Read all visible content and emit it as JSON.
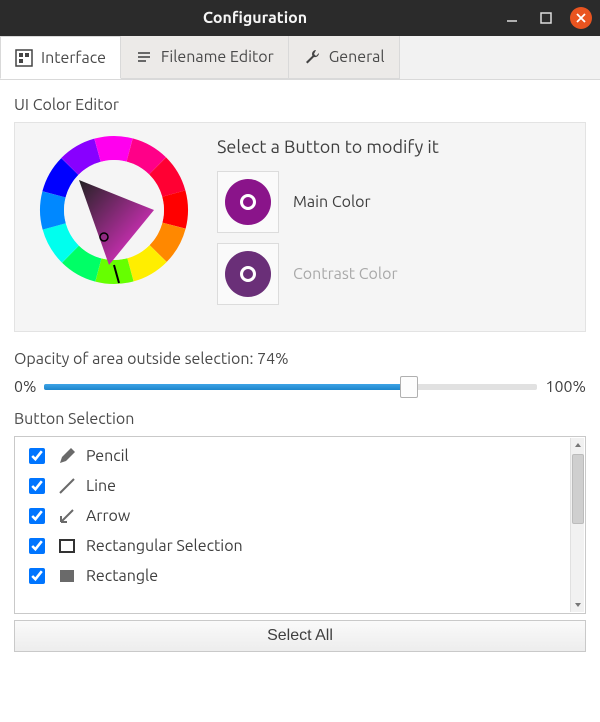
{
  "window": {
    "title": "Configuration"
  },
  "tabs": {
    "interface": "Interface",
    "filename": "Filename Editor",
    "general": "General",
    "active": "interface"
  },
  "colorEditor": {
    "heading": "UI Color Editor",
    "hint": "Select a Button to modify it",
    "main": {
      "label": "Main Color",
      "hex": "#8a148a"
    },
    "contrast": {
      "label": "Contrast Color",
      "hex": "#6a2f78"
    }
  },
  "opacity": {
    "label": "Opacity of area outside selection: 74%",
    "value": 74,
    "minLabel": "0%",
    "maxLabel": "100%"
  },
  "buttonSelection": {
    "heading": "Button Selection",
    "items": [
      {
        "label": "Pencil",
        "checked": true
      },
      {
        "label": "Line",
        "checked": true
      },
      {
        "label": "Arrow",
        "checked": true
      },
      {
        "label": "Rectangular Selection",
        "checked": true
      },
      {
        "label": "Rectangle",
        "checked": true
      }
    ],
    "selectAll": "Select All"
  }
}
